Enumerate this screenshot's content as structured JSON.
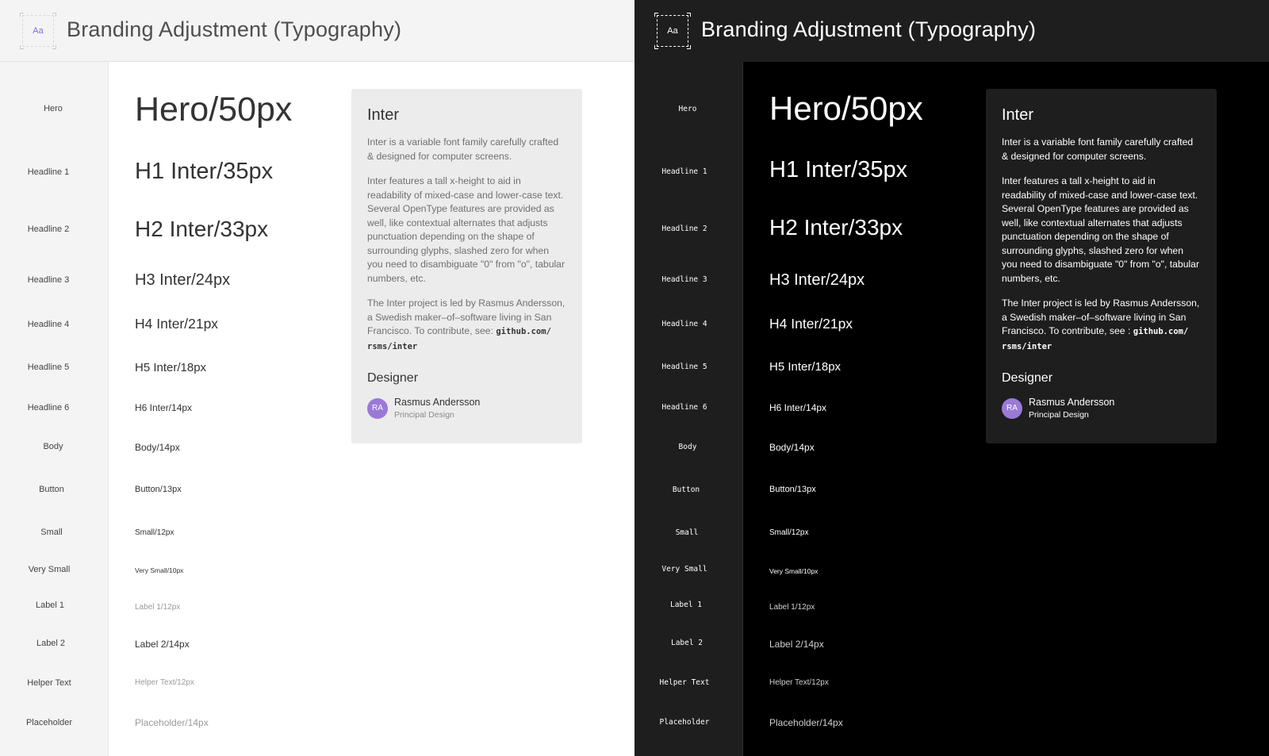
{
  "header": {
    "logo_text": "Aa",
    "title": "Branding Adjustment (Typography)"
  },
  "styles": [
    {
      "label": "Hero",
      "sample": "Hero/50px"
    },
    {
      "label": "Headline 1",
      "sample": "H1 Inter/35px"
    },
    {
      "label": "Headline 2",
      "sample": "H2 Inter/33px"
    },
    {
      "label": "Headline 3",
      "sample": "H3 Inter/24px"
    },
    {
      "label": "Headline 4",
      "sample": "H4 Inter/21px"
    },
    {
      "label": "Headline 5",
      "sample": "H5 Inter/18px"
    },
    {
      "label": "Headline 6",
      "sample": "H6 Inter/14px"
    },
    {
      "label": "Body",
      "sample": "Body/14px"
    },
    {
      "label": "Button",
      "sample": "Button/13px"
    },
    {
      "label": "Small",
      "sample": "Small/12px"
    },
    {
      "label": "Very Small",
      "sample": "Very Small/10px"
    },
    {
      "label": "Label 1",
      "sample": "Label 1/12px"
    },
    {
      "label": "Label 2",
      "sample": "Label 2/14px"
    },
    {
      "label": "Helper Text",
      "sample": "Helper Text/12px"
    },
    {
      "label": "Placeholder",
      "sample": "Placeholder/14px"
    }
  ],
  "card_light": {
    "title": "Inter",
    "p1": "Inter is a variable font family carefully crafted & designed for computer screens.",
    "p2": "Inter features a tall x-height to aid in readability of mixed-case and lower-case text. Several OpenType features are provided as well, like contextual alternates that adjusts punctuation depending on the shape of surrounding glyphs, slashed zero for when you need to disambiguate \"0\" from \"o\", tabular numbers, etc.",
    "p3": "The Inter project is led by Rasmus Andersson, a Swedish maker–of–software living in San Francisco. To contribute, see:",
    "p3_code": "github.com/ rsms/inter",
    "designer_heading": "Designer",
    "avatar_initials": "RA",
    "designer_name": "Rasmus Andersson",
    "designer_role": "Principal Design"
  },
  "card_dark": {
    "title": "Inter",
    "p1": "Inter is a variable font family carefully crafted & designed for computer screens.",
    "p2": "Inter features a tall x-height to aid in readability of mixed-case and lower-case text. Several OpenType features are provided as well, like contextual alternates that adjusts punctuation depending on the shape of surrounding glyphs, slashed zero for when you need to disambiguate \"0\" from \"o\", tabular numbers, etc.",
    "p3": "The Inter project is led by Rasmus Andersson, a Swedish maker–of–software living in San Francisco. To contribute, see :",
    "p3_code": "github.com/ rsms/inter",
    "designer_heading": "Designer",
    "avatar_initials": "RA",
    "designer_name": "Rasmus Andersson",
    "designer_role": "Principal Design"
  },
  "colors": {
    "accent": "#9b7ad6",
    "light_bg": "#ffffff",
    "light_sidebar": "#f4f4f4",
    "dark_bg": "#000000",
    "dark_sidebar": "#1e1e1e"
  }
}
